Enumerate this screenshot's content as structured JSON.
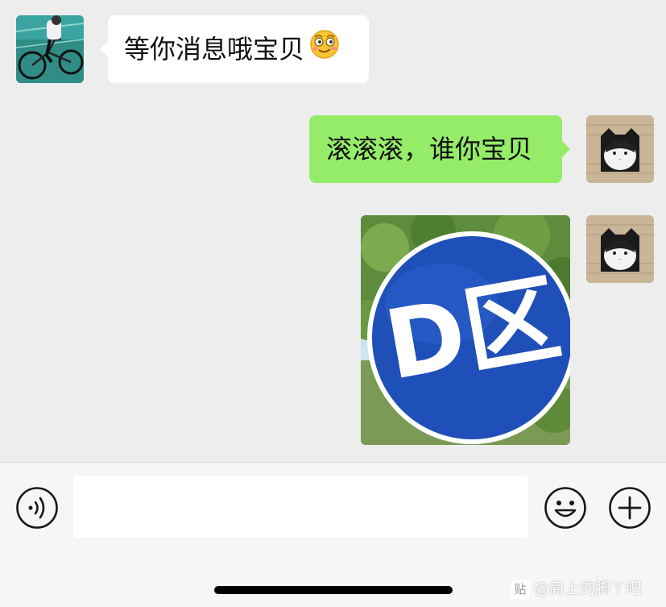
{
  "messages": [
    {
      "side": "left",
      "type": "text",
      "text": "等你消息哦宝贝",
      "emoji": "smirking-face"
    },
    {
      "side": "right",
      "type": "text",
      "text": "滚滚滚，谁你宝贝"
    },
    {
      "side": "right",
      "type": "image",
      "image_text": "D区"
    }
  ],
  "input_bar": {
    "voice_icon": "voice-icon",
    "emoji_icon": "smiley-icon",
    "plus_icon": "plus-icon",
    "text_value": ""
  },
  "watermark": {
    "logo": "贴",
    "text": "@肩上的脚丫吧"
  },
  "colors": {
    "background": "#ededed",
    "sent_bubble": "#95ec69",
    "received_bubble": "#ffffff",
    "sign_blue": "#1f4fb8"
  }
}
